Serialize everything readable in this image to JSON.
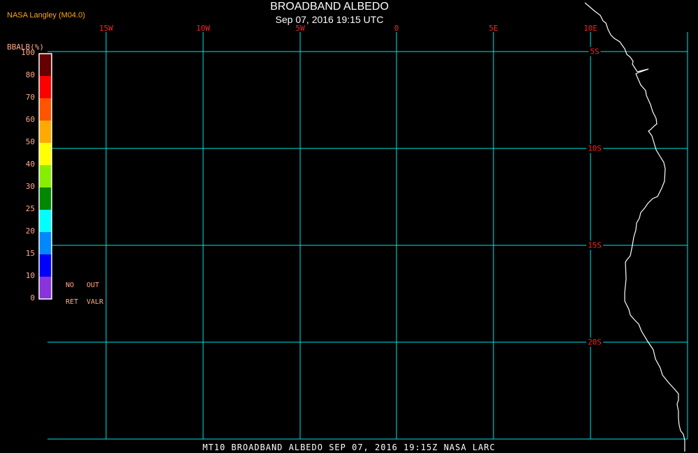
{
  "header": {
    "credit": "NASA Langley (M04.0)",
    "title": "BROADBAND ALBEDO",
    "subtitle": "Sep 07, 2016 19:15 UTC"
  },
  "colorbar": {
    "title": "BBALB(%)",
    "labels": [
      "100",
      "80",
      "70",
      "60",
      "50",
      "40",
      "30",
      "25",
      "20",
      "15",
      "10",
      "0"
    ],
    "colors": [
      "#660000",
      "#ff0000",
      "#ff5500",
      "#ffaa00",
      "#ffff00",
      "#88ee00",
      "#008800",
      "#00ffff",
      "#0088ff",
      "#0000ff",
      "#8833dd"
    ],
    "notes": [
      "NO",
      "OUT",
      "RET",
      "VALR"
    ]
  },
  "map": {
    "grid_color": "#00e5e5",
    "coast_color": "#ffffff",
    "lon_labels": [
      "15W",
      "10W",
      "5W",
      "0",
      "5E",
      "10E"
    ],
    "lat_labels": [
      "5S",
      "10S",
      "15S",
      "20S"
    ]
  },
  "footer": "MT10  BROADBAND ALBEDO  SEP 07, 2016 19:15Z  NASA LARC"
}
